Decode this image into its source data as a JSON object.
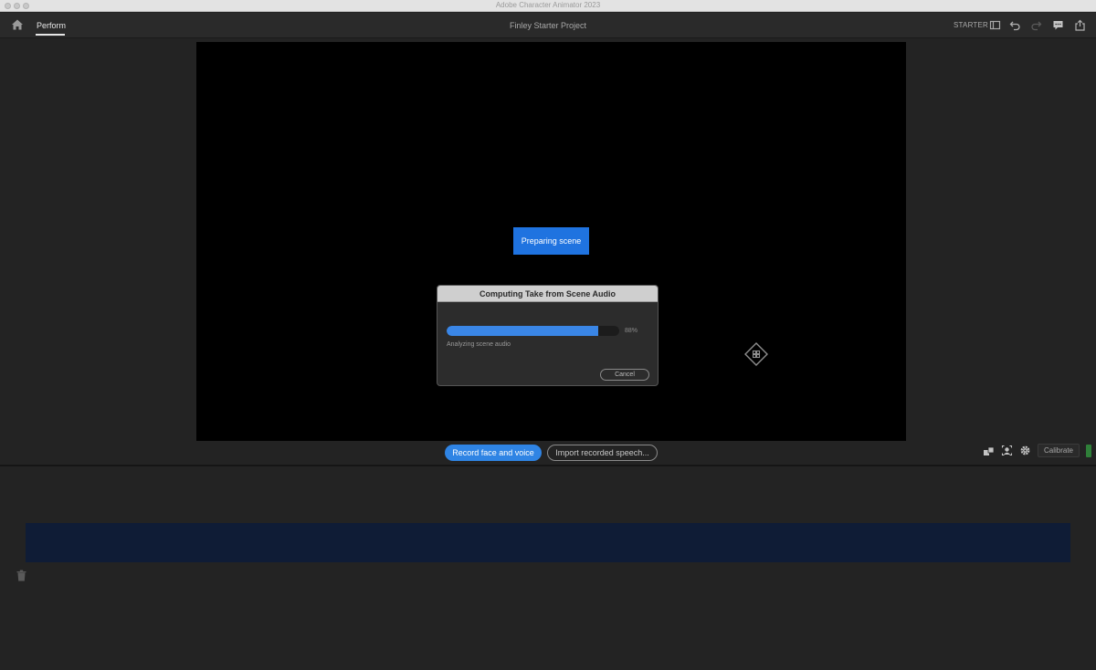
{
  "window": {
    "title": "Adobe Character Animator 2023"
  },
  "header": {
    "tab_perform": "Perform",
    "project_title": "Finley Starter Project",
    "mode_label": "STARTER",
    "icons": [
      "home-icon",
      "layout-icon",
      "undo-icon",
      "redo-icon",
      "comment-icon",
      "share-icon"
    ]
  },
  "stage": {
    "status_chip": "Preparing scene"
  },
  "dialog": {
    "title": "Computing Take from Scene Audio",
    "progress_percent_label": "88%",
    "progress_value": 0.88,
    "status_text": "Analyzing scene audio",
    "cancel_label": "Cancel"
  },
  "controls": {
    "record_label": "Record face and voice",
    "import_label": "Import recorded speech...",
    "calibrate_label": "Calibrate"
  },
  "colors": {
    "accent_blue": "#1f73e0",
    "progress_blue": "#3a86e6",
    "timeline_track": "#0f1c36",
    "level_green": "#2f7f39"
  }
}
